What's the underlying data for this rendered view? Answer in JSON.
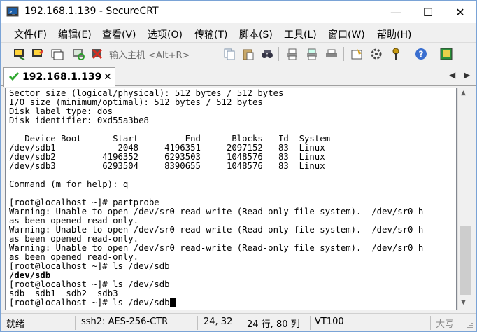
{
  "window": {
    "title": "192.168.1.139 - SecureCRT",
    "app_icon": "securecrt-icon",
    "controls": {
      "minimize": "—",
      "maximize": "☐",
      "close": "✕"
    }
  },
  "menu": [
    "文件(F)",
    "编辑(E)",
    "查看(V)",
    "选项(O)",
    "传输(T)",
    "脚本(S)",
    "工具(L)",
    "窗口(W)",
    "帮助(H)"
  ],
  "toolbar": {
    "host_placeholder": "输入主机 <Alt+R>",
    "icons": [
      "connect-icon",
      "quick-connect-icon",
      "connect-tab-icon",
      "reconnect-icon",
      "disconnect-icon",
      "copy-icon",
      "paste-icon",
      "find-icon",
      "print-icon",
      "print-selection-icon",
      "printer-icon",
      "session-options-icon",
      "global-options-icon",
      "keymap-icon",
      "help-icon",
      "sftp-icon"
    ]
  },
  "tab": {
    "label": "192.168.1.139",
    "close": "✕",
    "nav_left": "◀",
    "nav_right": "▶"
  },
  "terminal": {
    "lines": [
      "Sector size (logical/physical): 512 bytes / 512 bytes",
      "I/O size (minimum/optimal): 512 bytes / 512 bytes",
      "Disk label type: dos",
      "Disk identifier: 0xd55a3be8",
      "",
      "   Device Boot      Start         End      Blocks   Id  System",
      "/dev/sdb1            2048     4196351     2097152   83  Linux",
      "/dev/sdb2         4196352     6293503     1048576   83  Linux",
      "/dev/sdb3         6293504     8390655     1048576   83  Linux",
      "",
      "Command (m for help): q",
      "",
      "[root@localhost ~]# partprobe",
      "Warning: Unable to open /dev/sr0 read-write (Read-only file system).  /dev/sr0 h",
      "as been opened read-only.",
      "Warning: Unable to open /dev/sr0 read-write (Read-only file system).  /dev/sr0 h",
      "as been opened read-only.",
      "Warning: Unable to open /dev/sr0 read-write (Read-only file system).  /dev/sr0 h",
      "as been opened read-only.",
      "[root@localhost ~]# ls /dev/sdb",
      "/dev/sdb",
      "[root@localhost ~]# ls /dev/sdb",
      "sdb  sdb1  sdb2  sdb3",
      "[root@localhost ~]# ls /dev/sdb"
    ],
    "bold_line_index": 20
  },
  "status": {
    "ready": "就绪",
    "cipher": "ssh2: AES-256-CTR",
    "position": "24,  32",
    "rows_cols": "24 行, 80 列",
    "terminal_type": "VT100",
    "caps": "大写"
  }
}
